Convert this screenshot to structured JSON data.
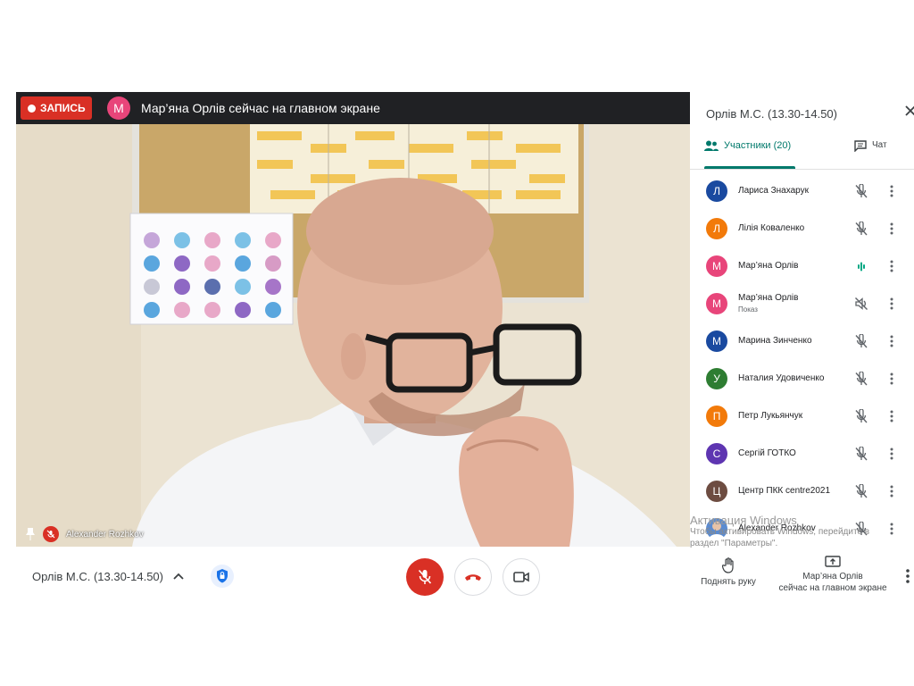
{
  "video": {
    "rec_label": "ЗАПИСЬ",
    "presenter_initial": "М",
    "presenter_color": "#e8457a",
    "presenter_message": "Мар’яна Орлів сейчас на главном экране",
    "tile_name": "Alexander Rozhkov"
  },
  "bottom": {
    "meeting_title": "Орлів М.С. (13.30-14.50)",
    "raise_hand": "Поднять руку",
    "share_line1": "Мар’яна Орлів",
    "share_line2": "сейчас на главном экране",
    "colors": {
      "end_call": "#d93025",
      "mic_off_bg": "#d93025"
    }
  },
  "panel": {
    "title": "Орлів М.С. (13.30-14.50)",
    "tab_people": "Участники (20)",
    "tab_chat": "Чат",
    "accent": "#00796b",
    "participants": [
      {
        "initial": "Л",
        "name": "Лариса Знахарук",
        "color": "#1a4aa0",
        "mic": "muted"
      },
      {
        "initial": "Л",
        "name": "Лілія Коваленко",
        "color": "#f27a0a",
        "mic": "muted"
      },
      {
        "initial": "М",
        "name": "Мар’яна Орлів",
        "color": "#e8457a",
        "mic": "speaking"
      },
      {
        "initial": "М",
        "name": "Мар’яна Орлів",
        "sub": "Показ",
        "color": "#e8457a",
        "mic": "presenting"
      },
      {
        "initial": "М",
        "name": "Марина Зинченко",
        "color": "#1a4aa0",
        "mic": "muted"
      },
      {
        "initial": "У",
        "name": "Наталия Удовиченко",
        "color": "#2e7d32",
        "mic": "muted"
      },
      {
        "initial": "П",
        "name": "Петр Лукьянчук",
        "color": "#f27a0a",
        "mic": "muted"
      },
      {
        "initial": "С",
        "name": "Сергій ГОТКО",
        "color": "#5e35b1",
        "mic": "muted"
      },
      {
        "initial": "Ц",
        "name": "Центр ПКК centre2021",
        "color": "#6d4c41",
        "mic": "muted"
      },
      {
        "initial": "",
        "name": "Alexander Rozhkov",
        "color": "#5b8bd0",
        "mic": "muted"
      }
    ]
  },
  "watermark": {
    "line1": "Активация Windows",
    "line2": "Чтобы активировать Windows, перейдите в",
    "line3": "раздел \"Параметры\"."
  }
}
